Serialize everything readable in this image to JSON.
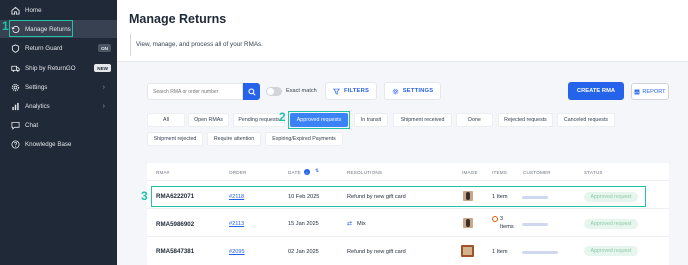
{
  "sidebar": {
    "items": [
      {
        "label": "Home",
        "icon": "home-icon"
      },
      {
        "label": "Manage Returns",
        "icon": "returns-icon"
      },
      {
        "label": "Return Guard",
        "icon": "shield-icon",
        "badge": "ON"
      },
      {
        "label": "Ship by ReturnGO",
        "icon": "truck-icon",
        "badge": "NEW"
      },
      {
        "label": "Settings",
        "icon": "gear-icon"
      },
      {
        "label": "Analytics",
        "icon": "chart-icon"
      },
      {
        "label": "Chat",
        "icon": "chat-icon"
      },
      {
        "label": "Knowledge Base",
        "icon": "help-icon"
      }
    ]
  },
  "steps": [
    "1",
    "2",
    "3"
  ],
  "header": {
    "title": "Manage Returns",
    "subtitle": "View, manage, and process all of your RMAs."
  },
  "toolbar": {
    "search_placeholder": "Search RMA or order number",
    "exact_match_label": "Exact match",
    "filters_label": "FILTERS",
    "settings_label": "SETTINGS",
    "create_rma_label": "CREATE RMA",
    "report_label": "REPORT"
  },
  "tabs": [
    "All",
    "Open RMAs",
    "Pending requests",
    "Approved requests",
    "In transit",
    "Shipment received",
    "Done",
    "Rejected requests",
    "Canceled requests",
    "Shipment rejected",
    "Require attention",
    "Expiring/Expired Payments"
  ],
  "table": {
    "headers": {
      "rma": "RMA#",
      "order": "ORDER",
      "date": "DATE",
      "resolutions": "RESOLUTIONS",
      "image": "IMAGE",
      "items": "ITEMS",
      "customer": "CUSTOMER",
      "status": "STATUS"
    },
    "rows": [
      {
        "rma": "RMA6222071",
        "order": "#2118",
        "date": "10 Feb 2025",
        "resolution": "Refund by new gift card",
        "items": "1 Item",
        "status": "Approved request"
      },
      {
        "rma": "RMA5986902",
        "order": "#2113",
        "date": "15 Jan 2025",
        "resolution": "Mix",
        "items": "3 Items",
        "items_line1": "3",
        "items_line2": "Items",
        "status": "Approved request"
      },
      {
        "rma": "RMA5847381",
        "order": "#2095",
        "date": "02 Jan 2025",
        "resolution": "Refund by new gift card",
        "items": "1 Item",
        "status": "Approved request"
      }
    ]
  },
  "colors": {
    "sidebar_bg": "#1f2937",
    "accent": "#2563eb",
    "highlight": "#22c1a8",
    "status_bg": "#e6f6ee"
  }
}
